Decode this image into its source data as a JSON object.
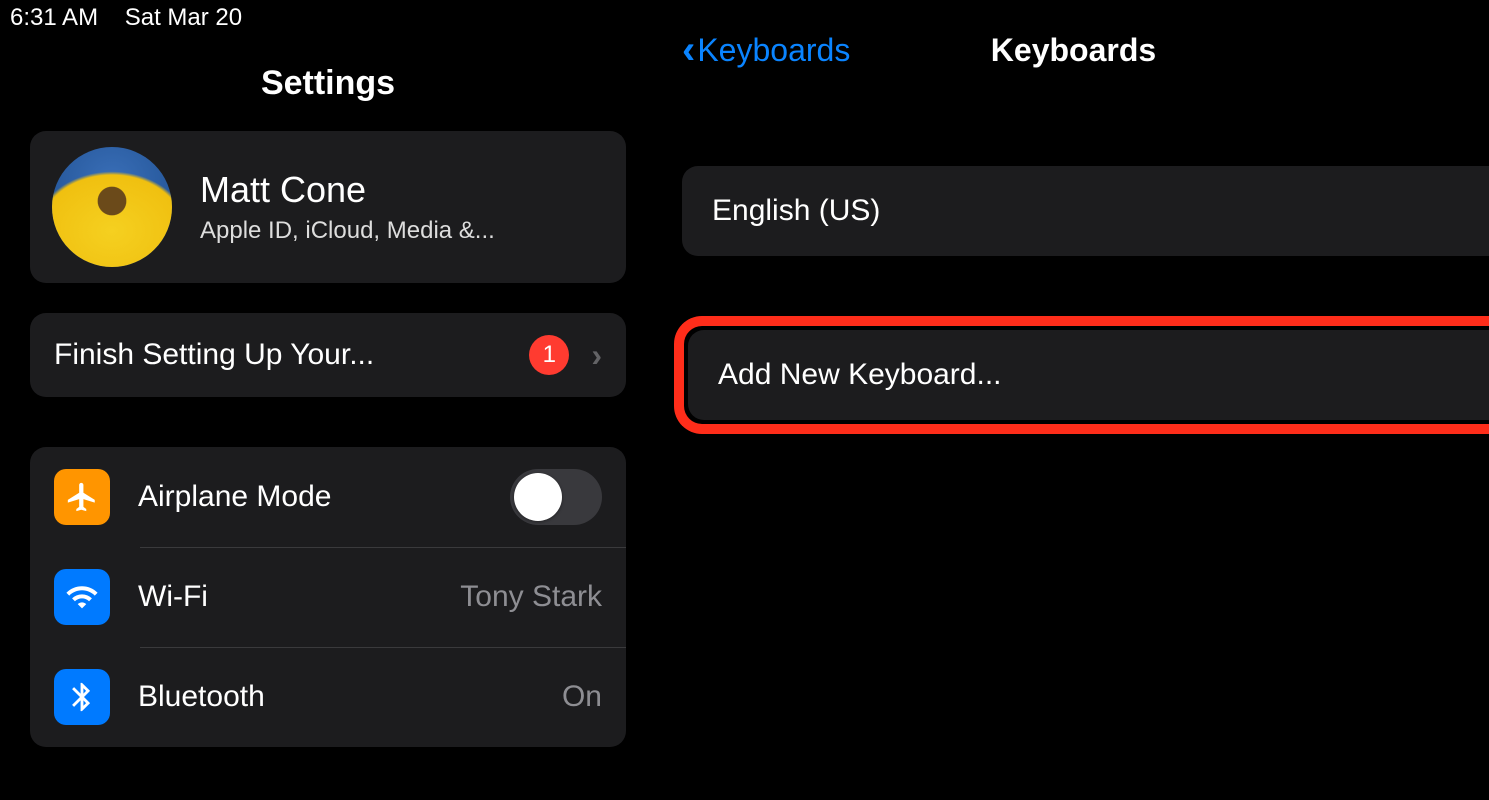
{
  "status_bar": {
    "time": "6:31 AM",
    "date": "Sat Mar 20"
  },
  "sidebar": {
    "title": "Settings",
    "profile": {
      "name": "Matt Cone",
      "subtitle": "Apple ID, iCloud, Media &..."
    },
    "finish_setup": {
      "label": "Finish Setting Up Your...",
      "badge": "1"
    },
    "items": [
      {
        "label": "Airplane Mode",
        "value": "",
        "icon": "airplane",
        "toggle": false
      },
      {
        "label": "Wi-Fi",
        "value": "Tony Stark",
        "icon": "wifi"
      },
      {
        "label": "Bluetooth",
        "value": "On",
        "icon": "bluetooth"
      }
    ]
  },
  "detail": {
    "back_label": "Keyboards",
    "title": "Keyboards",
    "keyboards": [
      "English (US)"
    ],
    "add_label": "Add New Keyboard..."
  }
}
